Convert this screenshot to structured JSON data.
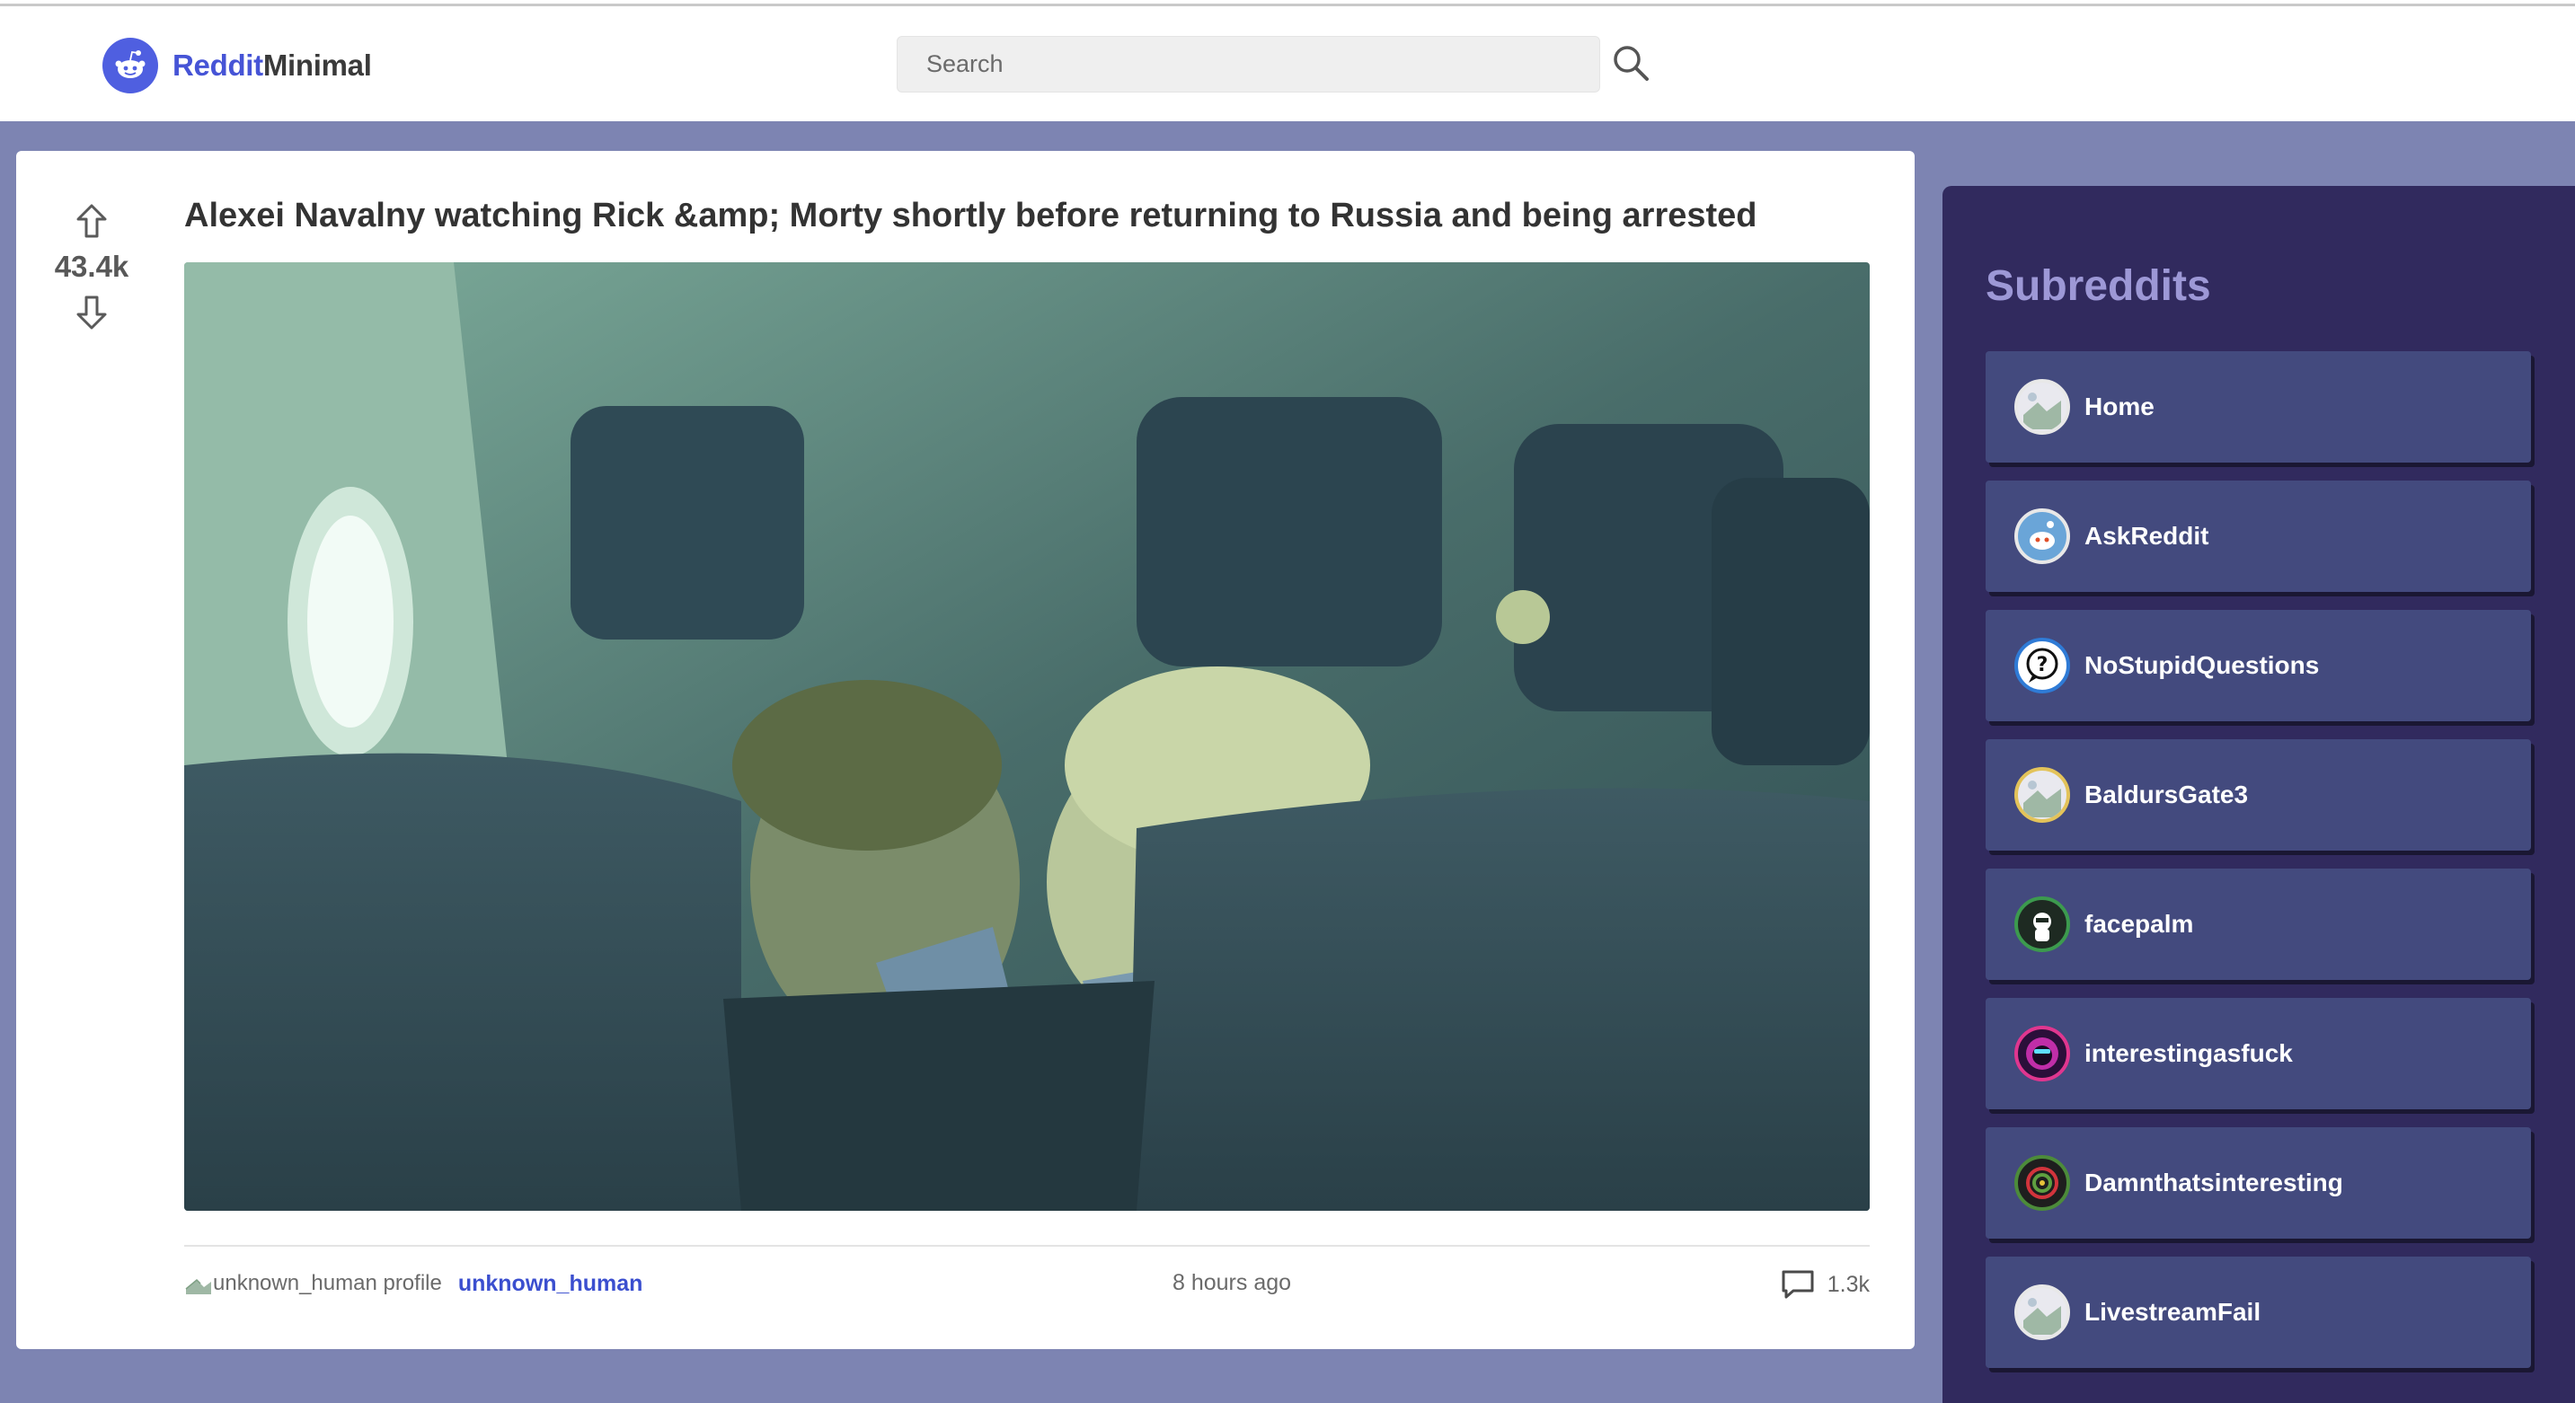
{
  "header": {
    "logo_prefix": "Reddit",
    "logo_suffix": "Minimal",
    "search_placeholder": "Search",
    "search_icon": "search-icon"
  },
  "post": {
    "score": "43.4k",
    "title": "Alexei Navalny watching Rick &amp; Morty shortly before returning to Russia and being arrested",
    "author_avatar_alt": "unknown_human profile",
    "author": "unknown_human",
    "time": "8 hours ago",
    "comments": "1.3k",
    "upvote_icon": "arrow-up-icon",
    "downvote_icon": "arrow-down-icon",
    "comment_icon": "comment-icon"
  },
  "sidebar": {
    "title": "Subreddits",
    "items": [
      {
        "label": "Home",
        "ring": "#e8e8e8"
      },
      {
        "label": "AskReddit",
        "ring": "#e8e8e8"
      },
      {
        "label": "NoStupidQuestions",
        "ring": "#2f7bd6"
      },
      {
        "label": "BaldursGate3",
        "ring": "#e3c35a"
      },
      {
        "label": "facepalm",
        "ring": "#3c9a4e"
      },
      {
        "label": "interestingasfuck",
        "ring": "#e0368f"
      },
      {
        "label": "Damnthatsinteresting",
        "ring": "#4c8b3a"
      },
      {
        "label": "LivestreamFail",
        "ring": "#e8e8e8"
      }
    ]
  },
  "colors": {
    "background": "#7d84b2",
    "sidebar": "#312a5e",
    "sidebar_item": "#434a7e",
    "accent": "#4654d6"
  }
}
